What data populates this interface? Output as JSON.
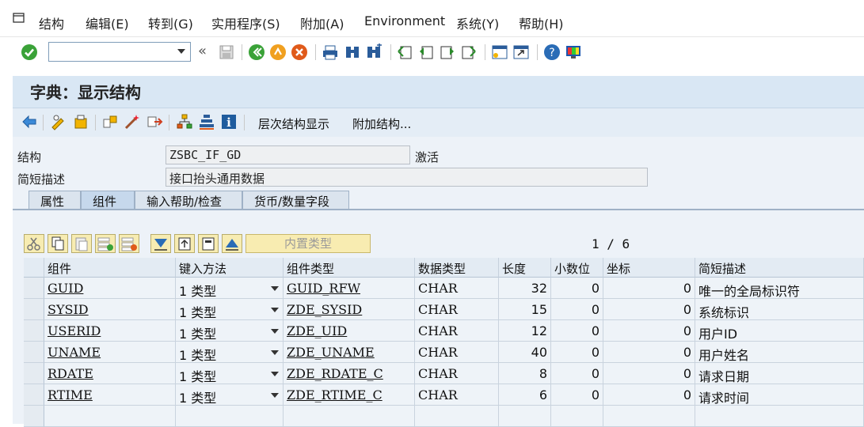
{
  "menu": {
    "items": [
      "结构",
      "编辑(E)",
      "转到(G)",
      "实用程序(S)",
      "附加(A)",
      "Environment",
      "系统(Y)",
      "帮助(H)"
    ]
  },
  "toolbar": {
    "command_value": "",
    "icons": [
      "enter-icon",
      "back-arrows-icon",
      "save-icon",
      "back-icon",
      "exit-icon",
      "cancel-icon",
      "print-icon",
      "find-icon",
      "find-next-icon",
      "first-page-icon",
      "prev-page-icon",
      "next-page-icon",
      "last-page-icon",
      "new-session-icon",
      "shortcut-icon",
      "help-icon",
      "customize-layout-icon"
    ]
  },
  "title": "字典：显示结构",
  "app_toolbar": {
    "hierarchy_label": "层次结构显示",
    "append_label": "附加结构..."
  },
  "form": {
    "structure_label": "结构",
    "structure_value": "ZSBC_IF_GD",
    "status": "激活",
    "desc_label": "简短描述",
    "desc_value": "接口抬头通用数据"
  },
  "tabs": [
    {
      "label": "属性",
      "active": false
    },
    {
      "label": "组件",
      "active": true
    },
    {
      "label": "输入帮助/检查",
      "active": false
    },
    {
      "label": "货币/数量字段",
      "active": false
    }
  ],
  "table_toolbar": {
    "inner_type_label": "内置类型",
    "page_info": "1 / 6"
  },
  "table": {
    "headers": [
      "组件",
      "键入方法",
      "组件类型",
      "数据类型",
      "长度",
      "小数位",
      "坐标",
      "简短描述"
    ],
    "rows": [
      {
        "component": "GUID",
        "typing": "1 类型",
        "comp_type": "GUID_RFW",
        "data_type": "CHAR",
        "length": "32",
        "decimals": "0",
        "coord": "0",
        "desc": "唯一的全局标识符"
      },
      {
        "component": "SYSID",
        "typing": "1 类型",
        "comp_type": "ZDE_SYSID",
        "data_type": "CHAR",
        "length": "15",
        "decimals": "0",
        "coord": "0",
        "desc": "系统标识"
      },
      {
        "component": "USERID",
        "typing": "1 类型",
        "comp_type": "ZDE_UID",
        "data_type": "CHAR",
        "length": "12",
        "decimals": "0",
        "coord": "0",
        "desc": "用户ID"
      },
      {
        "component": "UNAME",
        "typing": "1 类型",
        "comp_type": "ZDE_UNAME",
        "data_type": "CHAR",
        "length": "40",
        "decimals": "0",
        "coord": "0",
        "desc": "用户姓名"
      },
      {
        "component": "RDATE",
        "typing": "1 类型",
        "comp_type": "ZDE_RDATE_C",
        "data_type": "CHAR",
        "length": "8",
        "decimals": "0",
        "coord": "0",
        "desc": "请求日期"
      },
      {
        "component": "RTIME",
        "typing": "1 类型",
        "comp_type": "ZDE_RTIME_C",
        "data_type": "CHAR",
        "length": "6",
        "decimals": "0",
        "coord": "0",
        "desc": "请求时间"
      }
    ]
  },
  "colors": {
    "title_band": "#d9e7f4",
    "app_toolbar": "#e4edf6",
    "form_bg": "#edf2f8",
    "table_header": "#e3ebf3",
    "enter_green": "#3aa238"
  }
}
